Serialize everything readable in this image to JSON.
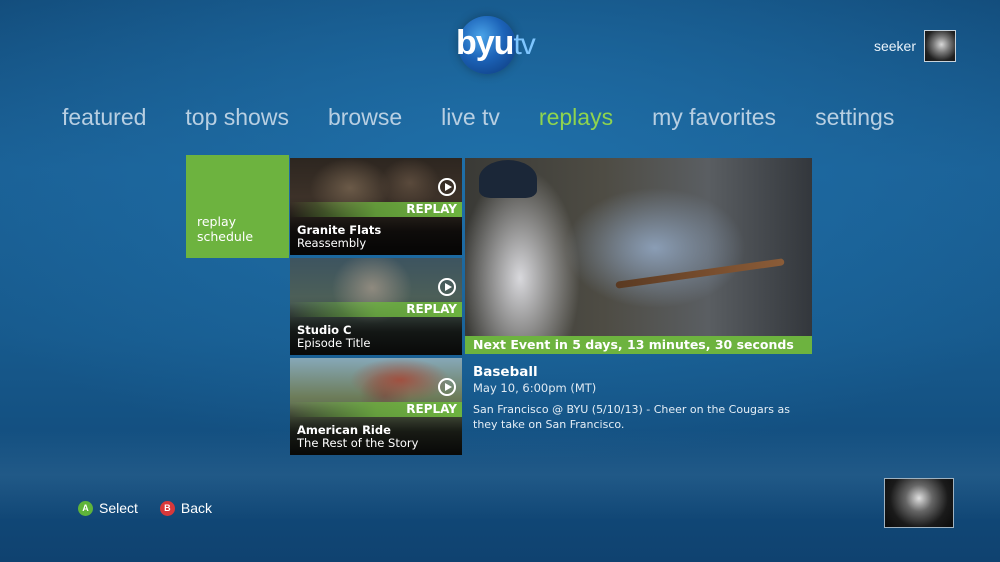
{
  "app": {
    "logo_text": "byu",
    "logo_suffix": "tv"
  },
  "user": {
    "name": "seeker",
    "avatar_icon": "user-avatar"
  },
  "nav": {
    "items": [
      {
        "label": "featured",
        "active": false
      },
      {
        "label": "top shows",
        "active": false
      },
      {
        "label": "browse",
        "active": false
      },
      {
        "label": "live tv",
        "active": false
      },
      {
        "label": "replays",
        "active": true
      },
      {
        "label": "my favorites",
        "active": false
      },
      {
        "label": "settings",
        "active": false
      }
    ]
  },
  "schedule_tile": {
    "label_line1": "replay",
    "label_line2": "schedule"
  },
  "replay_tiles": [
    {
      "badge": "REPLAY",
      "show": "Granite Flats",
      "episode": "Reassembly"
    },
    {
      "badge": "REPLAY",
      "show": "Studio C",
      "episode": "Episode Title"
    },
    {
      "badge": "REPLAY",
      "show": "American Ride",
      "episode": "The Rest of the Story"
    }
  ],
  "hero": {
    "caption": "Next Event in 5 days, 13 minutes, 30 seconds"
  },
  "event": {
    "title": "Baseball",
    "datetime": "May 10, 6:00pm (MT)",
    "description": "San Francisco @ BYU (5/10/13) - Cheer on the Cougars as they take on San Francisco."
  },
  "footer": {
    "a_key": "A",
    "a_label": "Select",
    "b_key": "B",
    "b_label": "Back"
  },
  "colors": {
    "accent_green": "#6db33f",
    "active_nav": "#8fd44e",
    "background": "#175a8d"
  }
}
